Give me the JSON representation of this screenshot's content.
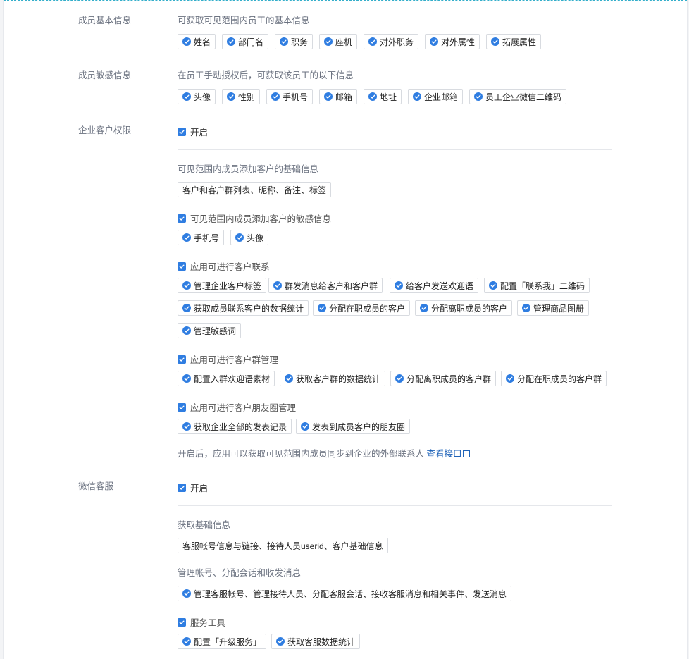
{
  "member_basic": {
    "label": "成员基本信息",
    "desc": "可获取可见范围内员工的基本信息",
    "tags": [
      "姓名",
      "部门名",
      "职务",
      "座机",
      "对外职务",
      "对外属性",
      "拓展属性"
    ]
  },
  "member_sensitive": {
    "label": "成员敏感信息",
    "desc": "在员工手动授权后，可获取该员工的以下信息",
    "tags": [
      "头像",
      "性别",
      "手机号",
      "邮箱",
      "地址",
      "企业邮箱",
      "员工企业微信二维码"
    ]
  },
  "customer": {
    "label": "企业客户权限",
    "enabled_label": "开启",
    "basic_title": "可见范围内成员添加客户的基础信息",
    "basic_tag": "客户和客户群列表、昵称、备注、标签",
    "sensitive_title": "可见范围内成员添加客户的敏感信息",
    "sensitive_tags": [
      "手机号",
      "头像"
    ],
    "contact_title": "应用可进行客户联系",
    "contact_tags": [
      "管理企业客户标签",
      "群发消息给客户和客户群",
      "给客户发送欢迎语",
      "配置「联系我」二维码",
      "获取成员联系客户的数据统计",
      "分配在职成员的客户",
      "分配离职成员的客户",
      "管理商品图册",
      "管理敏感词"
    ],
    "group_title": "应用可进行客户群管理",
    "group_tags": [
      "配置入群欢迎语素材",
      "获取客户群的数据统计",
      "分配离职成员的客户群",
      "分配在职成员的客户群"
    ],
    "moments_title": "应用可进行客户朋友圈管理",
    "moments_tags": [
      "获取企业全部的发表记录",
      "发表到成员客户的朋友圈"
    ],
    "note": "开启后，应用可以获取可见范围内成员同步到企业的外部联系人",
    "note_link": "查看接口"
  },
  "wechat_service": {
    "label": "微信客服",
    "enabled_label": "开启",
    "basic_title": "获取基础信息",
    "basic_tag": "客服帐号信息与链接、接待人员userid、客户基础信息",
    "manage_title": "管理帐号、分配会话和收发消息",
    "manage_tag": "管理客服帐号、管理接待人员、分配客服会话、接收客服消息和相关事件、发送消息",
    "tools_title": "服务工具",
    "tools_tags": [
      "配置「升级服务」",
      "获取客服数据统计"
    ]
  },
  "colors": {
    "accent": "#2f7de1",
    "link": "#1f63b8",
    "dash": "#33aeca"
  }
}
